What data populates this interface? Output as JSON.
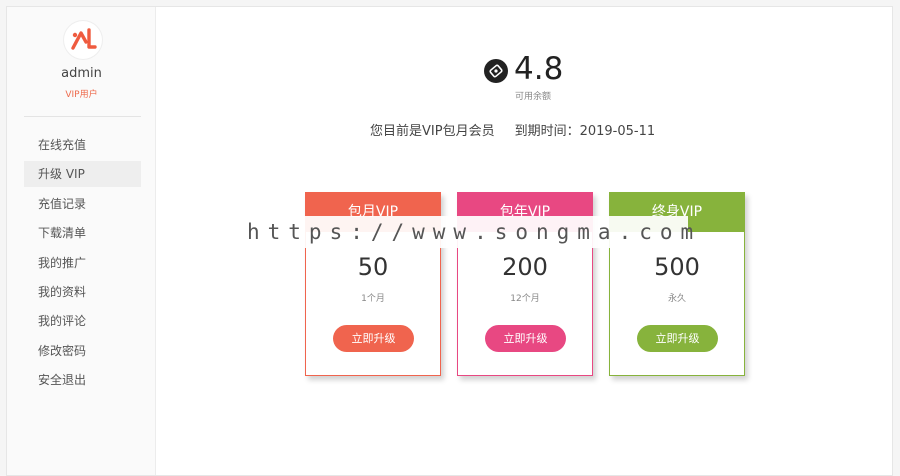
{
  "user": {
    "name": "admin",
    "tag": "VIP用户"
  },
  "sidebar": {
    "items": [
      {
        "label": "在线充值"
      },
      {
        "label": "升级 VIP"
      },
      {
        "label": "充值记录"
      },
      {
        "label": "下载清单"
      },
      {
        "label": "我的推广"
      },
      {
        "label": "我的资料"
      },
      {
        "label": "我的评论"
      },
      {
        "label": "修改密码"
      },
      {
        "label": "安全退出"
      }
    ],
    "active_index": 1
  },
  "balance": {
    "value": "4.8",
    "label": "可用余额",
    "icon": "coin-icon"
  },
  "membership": {
    "status": "您目前是VIP包月会员",
    "expiry_label": "到期时间：",
    "expiry_date": "2019-05-11"
  },
  "plans": [
    {
      "title": "包月VIP",
      "price": "50",
      "period": "1个月",
      "button": "立即升级",
      "color": "#f0644e"
    },
    {
      "title": "包年VIP",
      "price": "200",
      "period": "12个月",
      "button": "立即升级",
      "color": "#e84882"
    },
    {
      "title": "终身VIP",
      "price": "500",
      "period": "永久",
      "button": "立即升级",
      "color": "#87b33c"
    }
  ],
  "watermark": "https://www.songma.com"
}
